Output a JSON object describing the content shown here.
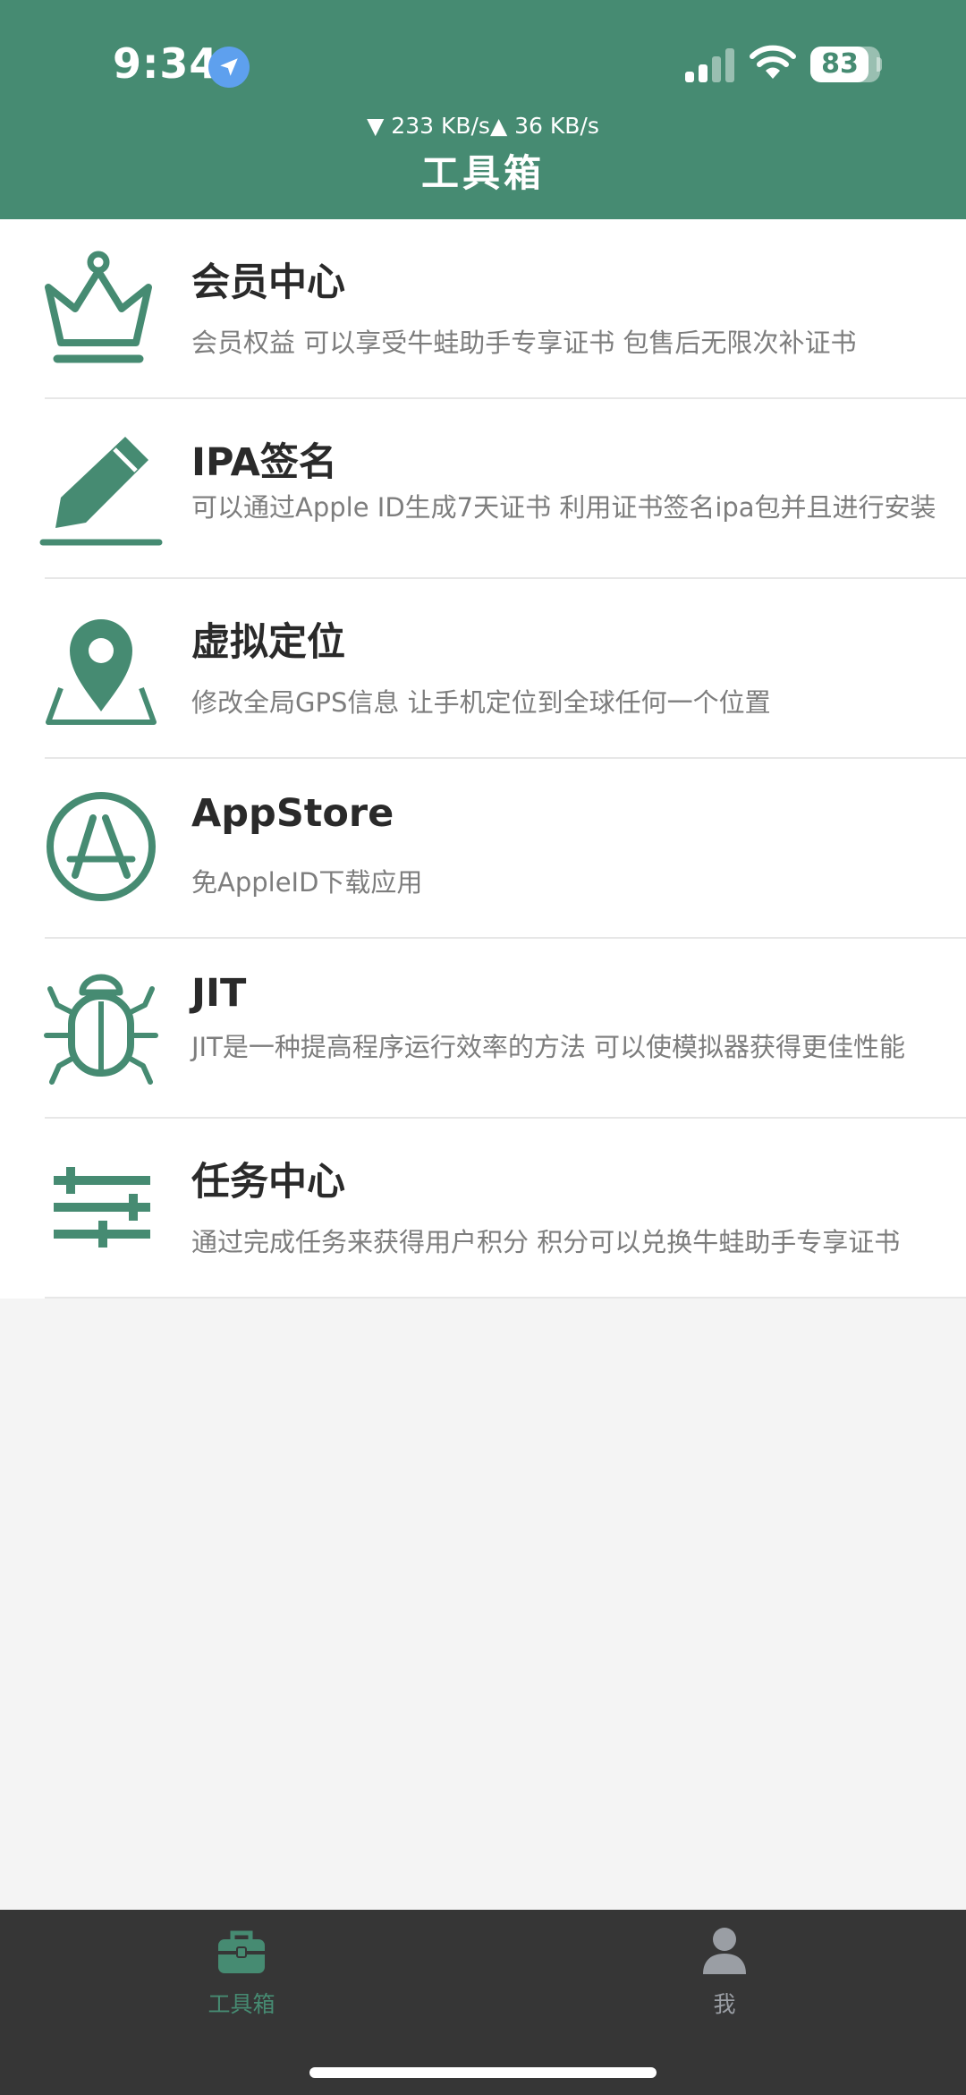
{
  "status_bar": {
    "time": "9:34",
    "location_icon": "location-arrow-icon",
    "signal_icon": "cellular-signal-icon",
    "wifi_icon": "wifi-icon",
    "battery_level": 83,
    "battery_text": "83"
  },
  "header": {
    "net_speed": "▼ 233 KB/s▲ 36 KB/s",
    "title": "工具箱",
    "background_color": "#468b72"
  },
  "tools": [
    {
      "icon": "crown-icon",
      "title": "会员中心",
      "description": "会员权益 可以享受牛蛙助手专享证书 包售后无限次补证书"
    },
    {
      "icon": "pencil-icon",
      "title": "IPA签名",
      "description": "可以通过Apple ID生成7天证书 利用证书签名ipa包并且进行安装"
    },
    {
      "icon": "map-pin-icon",
      "title": "虚拟定位",
      "description": "修改全局GPS信息 让手机定位到全球任何一个位置"
    },
    {
      "icon": "app-store-icon",
      "title": "AppStore",
      "description": "免AppleID下载应用"
    },
    {
      "icon": "bug-icon",
      "title": "JIT",
      "description": "JIT是一种提高程序运行效率的方法 可以使模拟器获得更佳性能"
    },
    {
      "icon": "sliders-icon",
      "title": "任务中心",
      "description": "通过完成任务来获得用户积分 积分可以兑换牛蛙助手专享证书"
    }
  ],
  "tab_bar": {
    "tabs": [
      {
        "label": "工具箱",
        "icon": "toolbox-icon",
        "active": true
      },
      {
        "label": "我",
        "icon": "person-icon",
        "active": false
      }
    ],
    "active_color": "#468b72",
    "inactive_color": "#9a9ea4"
  }
}
